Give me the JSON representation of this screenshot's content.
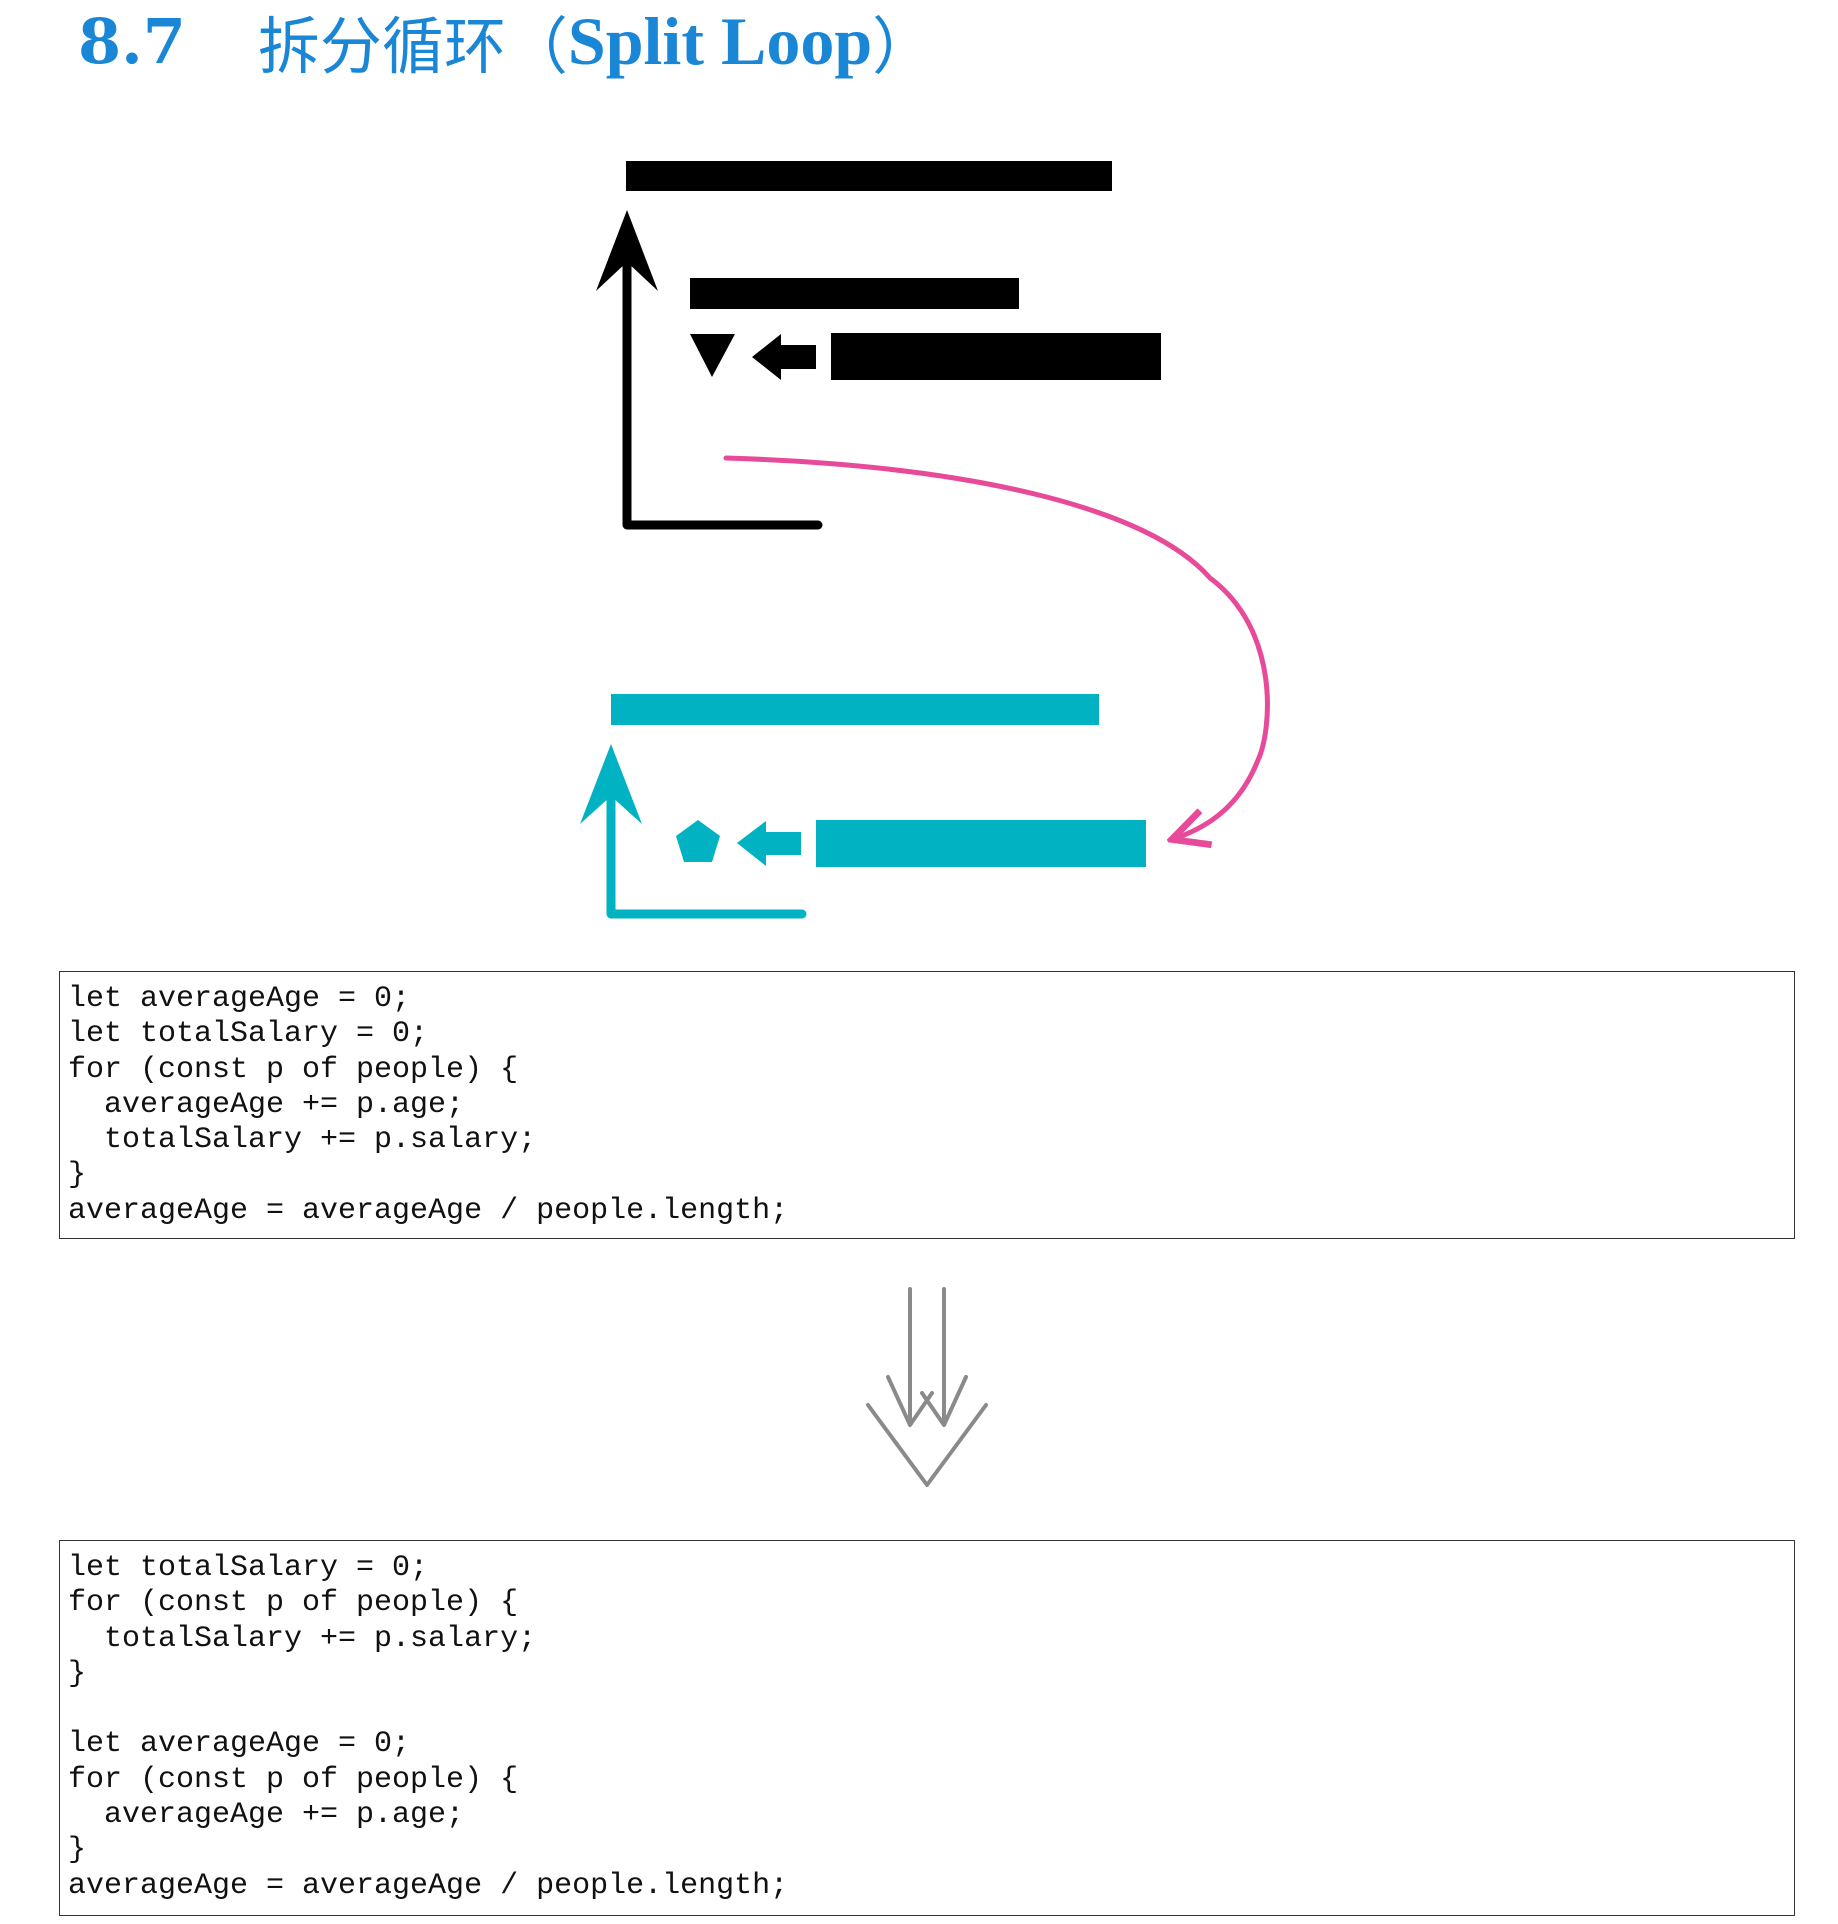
{
  "heading": {
    "number": "8.7",
    "title_zh": "拆分循环",
    "title_open": "（",
    "title_en": "Split Loop",
    "title_close": "）"
  },
  "colors": {
    "heading": "#1a86d6",
    "diagram_before": "#000000",
    "diagram_after": "#00b2c2",
    "move_arrow": "#e84a9a",
    "transform_arrow": "#8a8a8a"
  },
  "diagram": {
    "before_shapes": [
      "bar",
      "loop-up-arrow",
      "bar",
      "triangle-down",
      "left-arrow",
      "bar"
    ],
    "after_shapes": [
      "bar",
      "loop-up-arrow",
      "pentagon",
      "left-arrow",
      "bar"
    ],
    "connector": "curved-arrow"
  },
  "transform_icon": "split-down-arrows-icon",
  "code_before": "let averageAge = 0;\nlet totalSalary = 0;\nfor (const p of people) {\n  averageAge += p.age;\n  totalSalary += p.salary;\n}\naverageAge = averageAge / people.length;",
  "code_after": "let totalSalary = 0;\nfor (const p of people) {\n  totalSalary += p.salary;\n}\n\nlet averageAge = 0;\nfor (const p of people) {\n  averageAge += p.age;\n}\naverageAge = averageAge / people.length;"
}
